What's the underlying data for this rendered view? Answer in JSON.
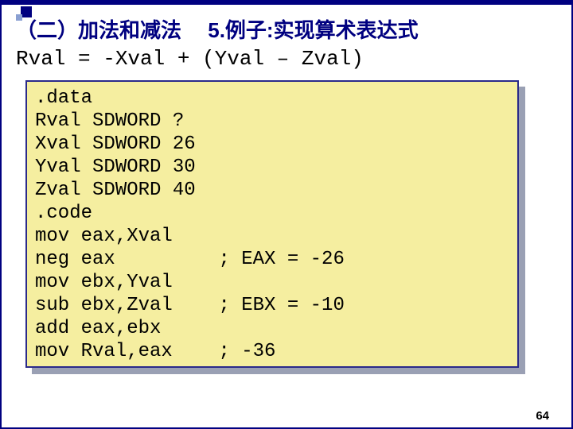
{
  "heading": {
    "section_label": "（二）加法和减法",
    "example_label": "5.例子:实现算术表达式"
  },
  "expression": "Rval = -Xval + (Yval – Zval)",
  "code_lines": [
    ".data",
    "Rval SDWORD ?",
    "Xval SDWORD 26",
    "Yval SDWORD 30",
    "Zval SDWORD 40",
    ".code",
    "mov eax,Xval",
    "neg eax         ; EAX = -26",
    "mov ebx,Yval",
    "sub ebx,Zval    ; EBX = -10",
    "add eax,ebx",
    "mov Rval,eax    ; -36"
  ],
  "page_number": "64"
}
